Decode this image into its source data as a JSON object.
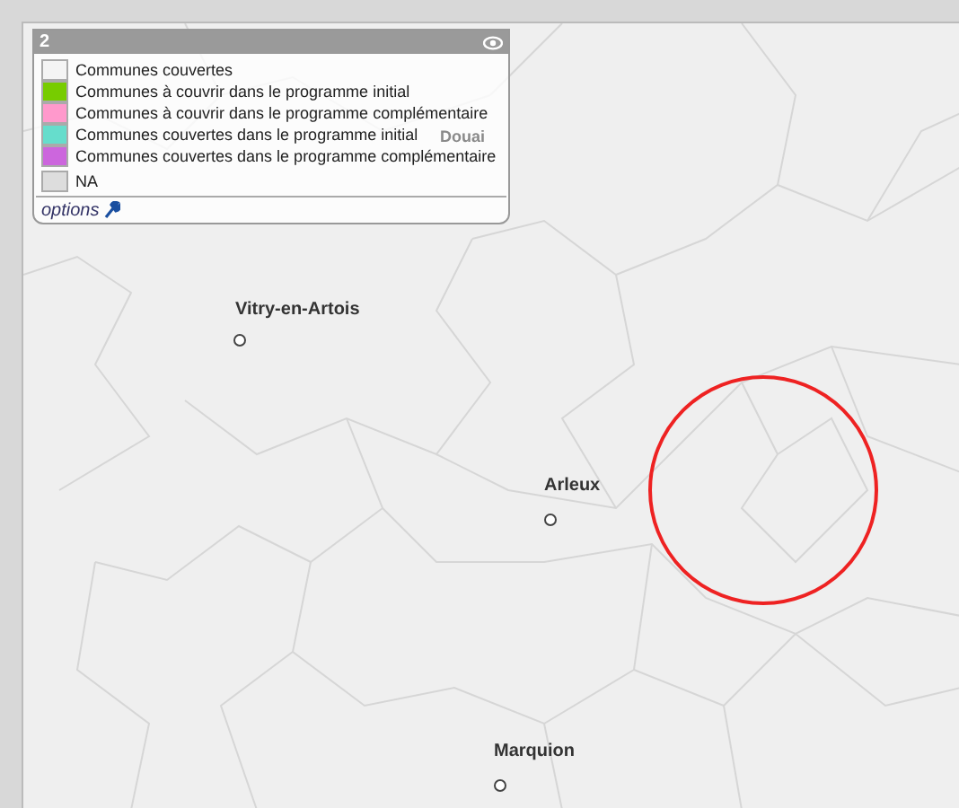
{
  "legend": {
    "title": "2",
    "items": [
      {
        "label": "Communes couvertes",
        "color": "#f4f4f4"
      },
      {
        "label": "Communes à couvrir dans le programme initial",
        "color": "#77cc00"
      },
      {
        "label": "Communes à couvrir dans le programme complémentaire",
        "color": "#ff99cc"
      },
      {
        "label": "Communes couvertes dans le programme initial",
        "color": "#66ddcc"
      },
      {
        "label": "Communes couvertes dans le programme complémentaire",
        "color": "#cc66dd"
      },
      {
        "label": "NA",
        "color": "#dddddd"
      }
    ],
    "options": "options"
  },
  "places": [
    {
      "name": "Douai",
      "kind": "faded"
    },
    {
      "name": "Vitry-en-Artois",
      "kind": "town"
    },
    {
      "name": "Arleux",
      "kind": "town"
    },
    {
      "name": "Marquion",
      "kind": "town"
    }
  ]
}
